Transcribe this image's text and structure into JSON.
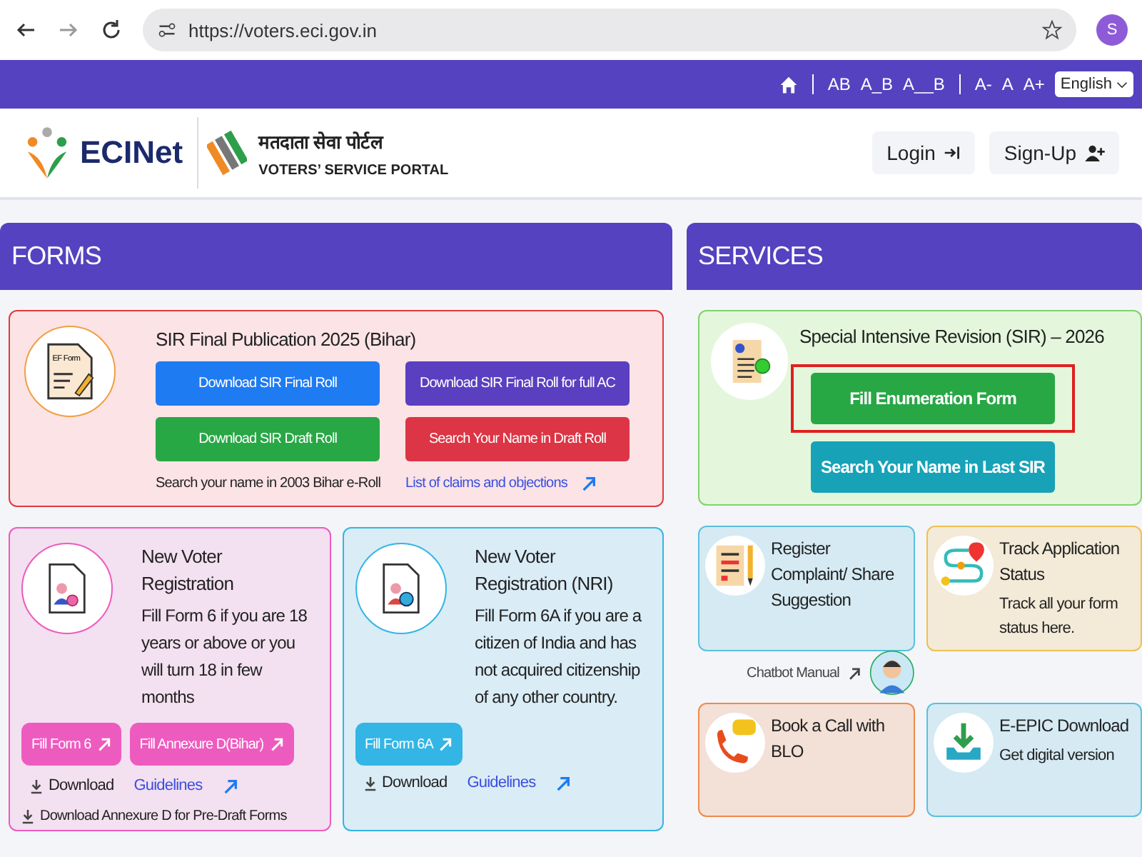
{
  "browser": {
    "url": "https://voters.eci.gov.in",
    "profile": "S"
  },
  "topbar": {
    "contrast": [
      "AB",
      "A_B",
      "A__B"
    ],
    "font_sizes": [
      "A-",
      "A",
      "A+"
    ],
    "language": "English"
  },
  "header": {
    "brand": "ECINet",
    "portal_hindi": "मतदाता सेवा पोर्टल",
    "portal": "VOTERS’ SERVICE PORTAL",
    "login": "Login",
    "signup": "Sign-Up"
  },
  "forms": {
    "title": "FORMS",
    "sir_card": {
      "title": "SIR Final Publication 2025 (Bihar)",
      "icon_label": "EF Form",
      "buttons": [
        {
          "label": "Download SIR Final Roll",
          "color": "#1e7bf2"
        },
        {
          "label": "Download SIR Final Roll for full AC",
          "color": "#5a3fc0"
        },
        {
          "label": "Download SIR Draft Roll",
          "color": "#28a745"
        },
        {
          "label": "Search Your Name in Draft Roll",
          "color": "#dc3545"
        }
      ],
      "links": [
        {
          "label": "Search your name in 2003 Bihar e-Roll",
          "kind": "plain"
        },
        {
          "label": "List of claims and objections",
          "kind": "blue"
        }
      ]
    },
    "cards": [
      {
        "title": "New Voter Registration",
        "text": "Fill Form 6 if you are 18 years or above or you will turn 18 in few months",
        "color": "#ee5bbf",
        "kind": "person-add",
        "buttons": [
          "Fill Form 6",
          "Fill Annexure D(Bihar)"
        ],
        "download": "Download",
        "guidelines": "Guidelines",
        "footer": "Download Annexure D for Pre-Draft Forms"
      },
      {
        "title": "New Voter Registration (NRI)",
        "text": "Fill Form 6A if you are a citizen of India and has not acquired citizenship of any other country.",
        "color": "#33b5e5",
        "kind": "person-globe",
        "buttons": [
          "Fill Form 6A"
        ],
        "download": "Download",
        "guidelines": "Guidelines"
      }
    ]
  },
  "services": {
    "title": "SERVICES",
    "sir_card": {
      "title": "Special Intensive Revision (SIR) – 2026",
      "buttons": [
        {
          "label": "Fill Enumeration Form",
          "color": "#28a745",
          "highlighted": true
        },
        {
          "label": "Search Your Name in Last SIR",
          "color": "#17a2b8",
          "highlighted": false
        }
      ]
    },
    "tiles": [
      {
        "title": "Register Complaint/ Share Suggestion",
        "color": "#5bc0de",
        "kind": "complaint"
      },
      {
        "title": "Track Application Status",
        "text": "Track all your form status here.",
        "color": "#f0c050",
        "kind": "track"
      },
      {
        "title": "Book a Call with BLO",
        "color": "#f08a4b",
        "kind": "phone"
      },
      {
        "title": "E-EPIC Download",
        "text": "Get digital version",
        "color": "#5bc0de",
        "kind": "download"
      }
    ],
    "chatbot": "Chatbot Manual"
  }
}
